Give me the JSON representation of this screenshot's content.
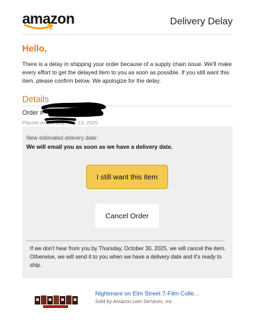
{
  "header": {
    "logo_text": "amazon",
    "title": "Delivery Delay"
  },
  "greeting": "Hello,",
  "intro": "There is a delay in shipping your order because of a supply chain issue. We'll make every effort to get the delayed item to you as soon as possible. If you still want this item, please confirm below. We apologize for the delay.",
  "details": {
    "heading": "Details",
    "order_label": "Order #",
    "placed_text": "Placed on Sunday, July 13, 2025"
  },
  "estimate": {
    "label": "New estimated delivery date:",
    "text": "We will email you as soon as we have a delivery date."
  },
  "buttons": {
    "confirm_label": "I still want this item",
    "cancel_label": "Cancel Order"
  },
  "footer_text": "If we don't hear from you by Thursday, October 30, 2025, we will cancel the item. Otherwise, we will send it to you when we have a delivery date and it's ready to ship.",
  "product": {
    "title": "Nightmare on Elm Street 7-Film Colle...",
    "seller": "Sold by Amazon.com Services, Inc"
  },
  "colors": {
    "accent_orange": "#e47911",
    "button_yellow": "#f3c94f",
    "link_blue": "#1d5ea6",
    "panel_gray": "#efefef"
  }
}
